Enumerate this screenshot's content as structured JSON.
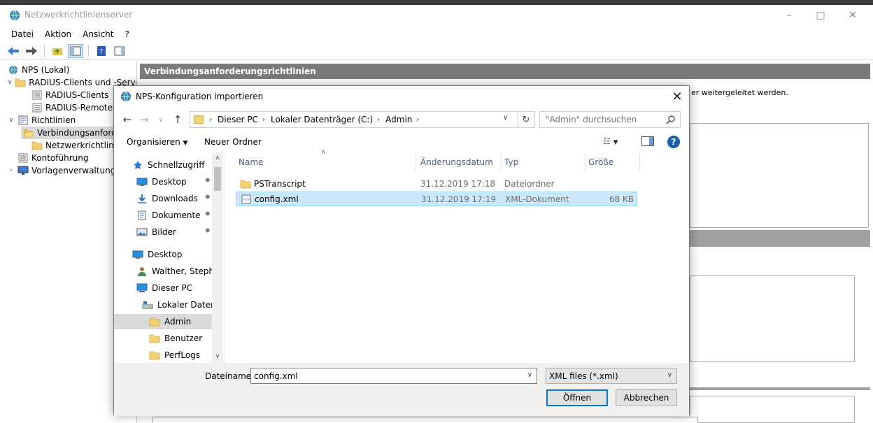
{
  "main_window": {
    "title": "Netzwerkrichtlinienserver",
    "menu": [
      "Datei",
      "Aktion",
      "Ansicht",
      "?"
    ]
  },
  "tree": {
    "items": [
      {
        "label": "NPS (Lokal)",
        "indent": 0,
        "expander": "",
        "icon": "globe-icon"
      },
      {
        "label": "RADIUS-Clients und -Server",
        "indent": 1,
        "expander": "v",
        "icon": "folder-icon"
      },
      {
        "label": "RADIUS-Clients",
        "indent": 2,
        "expander": "",
        "icon": "list-icon"
      },
      {
        "label": "RADIUS-Remoteserver",
        "indent": 2,
        "expander": "",
        "icon": "list-icon"
      },
      {
        "label": "Richtlinien",
        "indent": 1,
        "expander": "v",
        "icon": "document-icon"
      },
      {
        "label": "Verbindungsanforderungsrichtlinien",
        "indent": 2,
        "expander": "",
        "icon": "folder-open-icon",
        "selected": true
      },
      {
        "label": "Netzwerkrichtlinien",
        "indent": 2,
        "expander": "",
        "icon": "folder-icon"
      },
      {
        "label": "Kontoführung",
        "indent": 1,
        "expander": "",
        "icon": "list-icon"
      },
      {
        "label": "Vorlagenverwaltung",
        "indent": 1,
        "expander": ">",
        "icon": "monitor-icon"
      }
    ]
  },
  "right_pane": {
    "header": "Verbindungsanforderungsrichtlinien",
    "description_fragment": "er weitergeleitet werden."
  },
  "dialog": {
    "title": "NPS-Konfiguration importieren",
    "breadcrumb": [
      "Dieser PC",
      "Lokaler Datenträger (C:)",
      "Admin"
    ],
    "search_placeholder": "\"Admin\" durchsuchen",
    "organize_label": "Organisieren",
    "new_folder_label": "Neuer Ordner",
    "nav_items": [
      {
        "label": "Schnellzugriff",
        "icon": "star-icon",
        "indent": 1,
        "pin": false
      },
      {
        "label": "Desktop",
        "icon": "desktop-icon",
        "indent": 2,
        "pin": true
      },
      {
        "label": "Downloads",
        "icon": "download-icon",
        "indent": 2,
        "pin": true
      },
      {
        "label": "Dokumente",
        "icon": "documents-icon",
        "indent": 2,
        "pin": true
      },
      {
        "label": "Bilder",
        "icon": "pictures-icon",
        "indent": 2,
        "pin": true
      },
      {
        "label": "Desktop",
        "icon": "desktop-icon",
        "indent": 1,
        "pin": false
      },
      {
        "label": "Walther, Stephan",
        "icon": "user-icon",
        "indent": 2,
        "pin": false
      },
      {
        "label": "Dieser PC",
        "icon": "pc-icon",
        "indent": 2,
        "pin": false
      },
      {
        "label": "Lokaler Datenträger (C:)",
        "icon": "drive-icon",
        "indent": 3,
        "pin": false
      },
      {
        "label": "Admin",
        "icon": "folder-icon",
        "indent": 4,
        "pin": false,
        "selected": true
      },
      {
        "label": "Benutzer",
        "icon": "folder-icon",
        "indent": 4,
        "pin": false
      },
      {
        "label": "PerfLogs",
        "icon": "folder-icon",
        "indent": 4,
        "pin": false
      }
    ],
    "columns": [
      "Name",
      "Änderungsdatum",
      "Typ",
      "Größe"
    ],
    "files": [
      {
        "name": "PSTranscript",
        "date": "31.12.2019 17:18",
        "type": "Dateiordner",
        "size": "",
        "icon": "folder-icon",
        "selected": false
      },
      {
        "name": "config.xml",
        "date": "31.12.2019 17:19",
        "type": "XML-Dokument",
        "size": "68 KB",
        "icon": "xml-file-icon",
        "selected": true
      }
    ],
    "filename_label": "Dateiname:",
    "filename_value": "config.xml",
    "filetype_value": "XML files (*.xml)",
    "open_label": "Öffnen",
    "cancel_label": "Abbrechen"
  }
}
